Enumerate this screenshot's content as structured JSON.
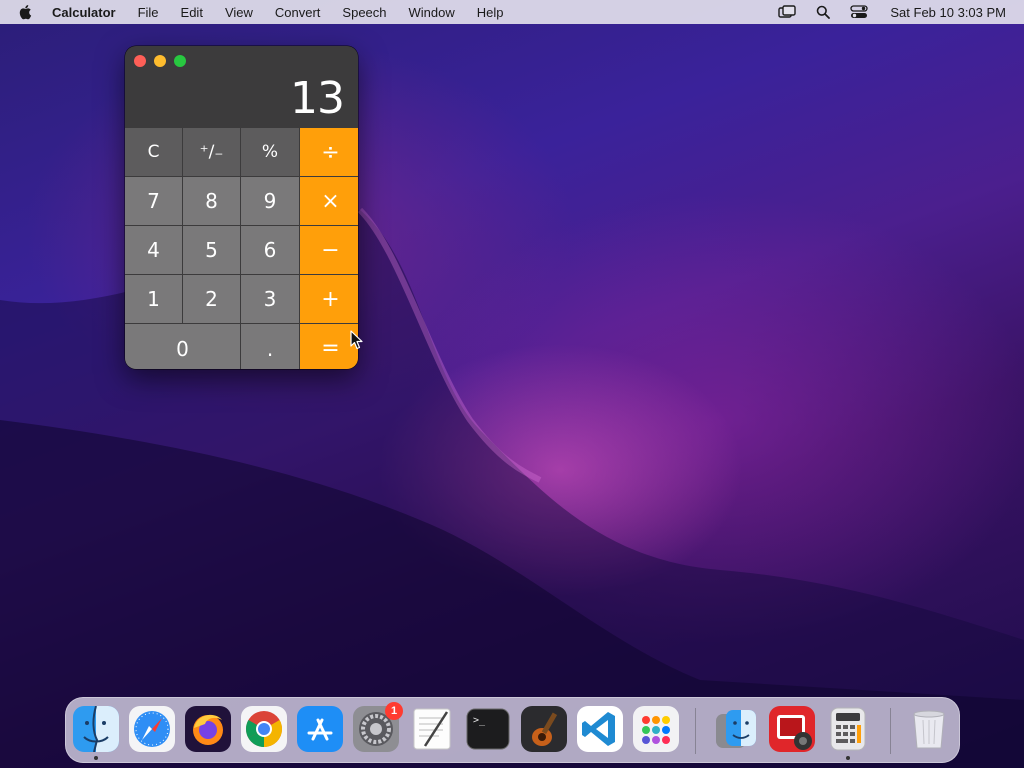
{
  "menubar": {
    "app_name": "Calculator",
    "menus": [
      "File",
      "Edit",
      "View",
      "Convert",
      "Speech",
      "Window",
      "Help"
    ],
    "status_icons": [
      "screen-mirroring-icon",
      "spotlight-search-icon",
      "control-center-icon"
    ],
    "clock": "Sat Feb 10  3:03 PM"
  },
  "calculator": {
    "window_controls": [
      "close",
      "minimize",
      "zoom"
    ],
    "display": "13",
    "keys": [
      {
        "label": "C",
        "kind": "fn",
        "name": "clear-key"
      },
      {
        "label": "⁺∕₋",
        "kind": "fn",
        "name": "sign-toggle-key"
      },
      {
        "label": "%",
        "kind": "fn",
        "name": "percent-key"
      },
      {
        "label": "÷",
        "kind": "op",
        "name": "divide-key"
      },
      {
        "label": "7",
        "kind": "num",
        "name": "digit-7-key"
      },
      {
        "label": "8",
        "kind": "num",
        "name": "digit-8-key"
      },
      {
        "label": "9",
        "kind": "num",
        "name": "digit-9-key"
      },
      {
        "label": "×",
        "kind": "op",
        "name": "multiply-key"
      },
      {
        "label": "4",
        "kind": "num",
        "name": "digit-4-key"
      },
      {
        "label": "5",
        "kind": "num",
        "name": "digit-5-key"
      },
      {
        "label": "6",
        "kind": "num",
        "name": "digit-6-key"
      },
      {
        "label": "−",
        "kind": "op",
        "name": "subtract-key"
      },
      {
        "label": "1",
        "kind": "num",
        "name": "digit-1-key"
      },
      {
        "label": "2",
        "kind": "num",
        "name": "digit-2-key"
      },
      {
        "label": "3",
        "kind": "num",
        "name": "digit-3-key"
      },
      {
        "label": "+",
        "kind": "op",
        "name": "add-key"
      },
      {
        "label": "0",
        "kind": "num",
        "name": "digit-0-key"
      },
      {
        "label": ".",
        "kind": "num",
        "name": "decimal-key"
      },
      {
        "label": "=",
        "kind": "op",
        "name": "equals-key"
      }
    ],
    "colors": {
      "operator": "#ff9f0a",
      "function": "#5d5c5d",
      "number": "#7a797a"
    }
  },
  "dock": {
    "apps": [
      {
        "name": "finder-icon",
        "running": true
      },
      {
        "name": "safari-icon",
        "running": false
      },
      {
        "name": "firefox-icon",
        "running": false
      },
      {
        "name": "chrome-icon",
        "running": false
      },
      {
        "name": "app-store-icon",
        "running": false
      },
      {
        "name": "system-preferences-icon",
        "running": false,
        "badge": "1"
      },
      {
        "name": "textedit-icon",
        "running": false
      },
      {
        "name": "terminal-icon",
        "running": false
      },
      {
        "name": "garageband-icon",
        "running": false
      },
      {
        "name": "vscode-icon",
        "running": false
      },
      {
        "name": "launchpad-icon",
        "running": false
      },
      {
        "name": "migration-assistant-icon",
        "running": false
      },
      {
        "name": "photo-booth-icon",
        "running": false
      },
      {
        "name": "calculator-icon",
        "running": true
      },
      {
        "name": "trash-icon",
        "running": false
      }
    ]
  }
}
